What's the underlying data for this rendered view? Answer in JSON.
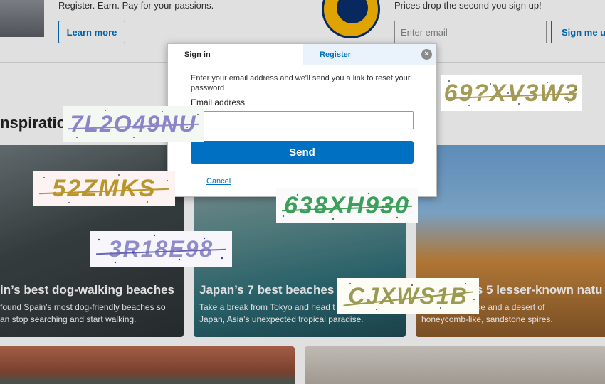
{
  "promos": {
    "left_text": "Register. Earn. Pay for your passions.",
    "learn_more": "Learn more",
    "right_text": "Prices drop the second you sign up!",
    "email_placeholder": "Enter email",
    "sign_me_up": "Sign me up"
  },
  "section": {
    "title": "inspiration"
  },
  "cards": [
    {
      "title": "in’s best dog-walking beaches",
      "desc": "found Spain’s most dog-friendly beaches so\nan stop searching and start walking."
    },
    {
      "title": "Japan’s 7 best beaches",
      "desc": "Take a break from Tokyo and head t\nJapan, Asia’s unexpected tropical paradise."
    },
    {
      "title": "Australia’s 5 lesser-known natu",
      "desc": "blegum pink lake and a desert of\nhoneycomb-like, sandstone spires."
    }
  ],
  "modal": {
    "tab_signin": "Sign in",
    "tab_register": "Register",
    "close_symbol": "×",
    "instruction": "Enter your email address and we'll send you a link to reset your password",
    "email_label": "Email address",
    "email_value": "",
    "send": "Send",
    "cancel": "Cancel"
  },
  "captchas": [
    {
      "text": "69?XV3W3",
      "color": "#a49a55"
    },
    {
      "text": "7L2O49NU",
      "color": "#8a85c9"
    },
    {
      "text": "52ZMKS",
      "color": "#b8962c"
    },
    {
      "text": "638XH930",
      "color": "#3aa05a"
    },
    {
      "text": "3R18E98",
      "color": "#8f8ccc"
    },
    {
      "text": "CJXWS1B",
      "color": "#9a9a52"
    }
  ]
}
